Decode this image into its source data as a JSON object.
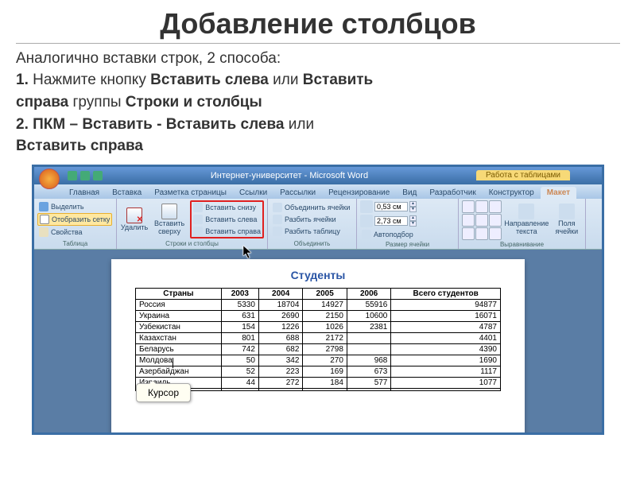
{
  "slide": {
    "title": "Добавление столбцов",
    "line1": "Аналогично вставки строк, 2 способа:",
    "line2a": "1.",
    "line2b": " Нажмите кнопку ",
    "line2c": "Вставить слева",
    "line2d": " или ",
    "line2e": "Вставить справа",
    "line2f": " группы ",
    "line2g": "Строки и столбцы",
    "line3a": "2. ПКМ – Вставить - Вставить слева",
    "line3b": " или",
    "line4": "Вставить справа"
  },
  "app": {
    "doc_title": "Интернет-университет - Microsoft Word",
    "contextual": "Работа с таблицами",
    "tabs": [
      "Главная",
      "Вставка",
      "Разметка страницы",
      "Ссылки",
      "Рассылки",
      "Рецензирование",
      "Вид",
      "Разработчик",
      "Конструктор",
      "Макет"
    ]
  },
  "ribbon": {
    "group_table": "Таблица",
    "select": "Выделить",
    "gridlines": "Отобразить сетку",
    "properties": "Свойства",
    "group_rows": "Строки и столбцы",
    "delete": "Удалить",
    "insert_above": "Вставить сверху",
    "insert_below": "Вставить снизу",
    "insert_left": "Вставить слева",
    "insert_right": "Вставить справа",
    "group_merge": "Объединить",
    "merge_cells": "Объединить ячейки",
    "split_cells": "Разбить ячейки",
    "split_table": "Разбить таблицу",
    "group_size": "Размер ячейки",
    "height": "0,53 см",
    "width": "2,73 см",
    "autofit": "Автоподбор",
    "group_align": "Выравнивание",
    "text_dir": "Направление текста",
    "cell_margins": "Поля ячейки"
  },
  "page": {
    "title": "Студенты"
  },
  "table": {
    "headers": [
      "Страны",
      "2003",
      "2004",
      "2005",
      "2006",
      "Всего студентов"
    ],
    "rows": [
      [
        "Россия",
        "5330",
        "18704",
        "14927",
        "55916",
        "94877"
      ],
      [
        "Украина",
        "631",
        "2690",
        "2150",
        "10600",
        "16071"
      ],
      [
        "Узбекистан",
        "154",
        "1226",
        "1026",
        "2381",
        "4787"
      ],
      [
        "Казахстан",
        "801",
        "688",
        "2172",
        "",
        "4401"
      ],
      [
        "Беларусь",
        "742",
        "682",
        "2798",
        "",
        "4390"
      ],
      [
        "Молдова",
        "50",
        "342",
        "270",
        "968",
        "1690"
      ],
      [
        "Азербайджан",
        "52",
        "223",
        "169",
        "673",
        "1117"
      ],
      [
        "Израиль",
        "44",
        "272",
        "184",
        "577",
        "1077"
      ],
      [
        "",
        "",
        "",
        "",
        "",
        ""
      ]
    ]
  },
  "callout": "Курсор"
}
